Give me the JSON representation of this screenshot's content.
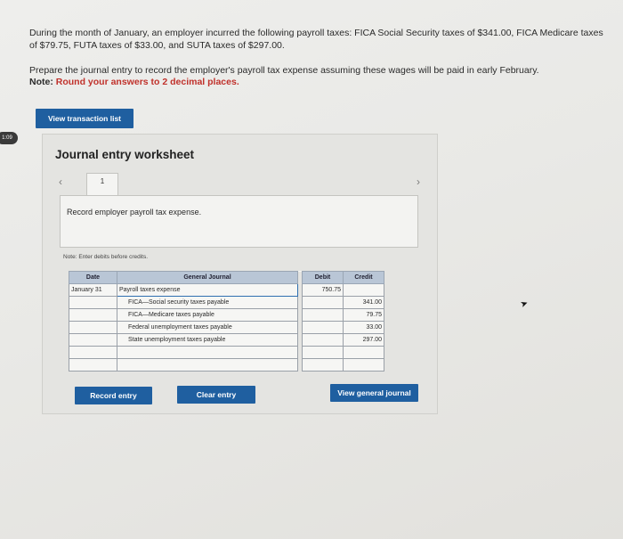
{
  "question": {
    "line1": "During the month of January, an employer incurred the following payroll taxes: FICA Social Security taxes of $341.00, FICA Medicare taxes of $79.75, FUTA taxes of $33.00, and SUTA taxes of $297.00.",
    "line2": "Prepare the journal entry to record the employer's payroll tax expense assuming these wages will be paid in early February.",
    "note_label": "Note:",
    "note_text": "Round your answers to 2 decimal places."
  },
  "buttons": {
    "view_transaction_list": "View transaction list",
    "record_entry": "Record entry",
    "clear_entry": "Clear entry",
    "view_general_journal": "View general journal"
  },
  "timer": "1:09",
  "worksheet": {
    "title": "Journal entry worksheet",
    "prev_icon": "‹",
    "next_icon": "›",
    "tab_number": "1",
    "record_text": "Record employer payroll tax expense.",
    "enter_note": "Note: Enter debits before credits."
  },
  "journal": {
    "headers": {
      "date": "Date",
      "general_journal": "General Journal",
      "debit": "Debit",
      "credit": "Credit"
    },
    "rows": [
      {
        "date": "January 31",
        "account": "Payroll taxes expense",
        "debit": "750.75",
        "credit": ""
      },
      {
        "date": "",
        "account": "FICA—Social security taxes payable",
        "debit": "",
        "credit": "341.00"
      },
      {
        "date": "",
        "account": "FICA—Medicare taxes payable",
        "debit": "",
        "credit": "79.75"
      },
      {
        "date": "",
        "account": "Federal unemployment taxes payable",
        "debit": "",
        "credit": "33.00"
      },
      {
        "date": "",
        "account": "State unemployment taxes payable",
        "debit": "",
        "credit": "297.00"
      },
      {
        "date": "",
        "account": "",
        "debit": "",
        "credit": ""
      },
      {
        "date": "",
        "account": "",
        "debit": "",
        "credit": ""
      }
    ]
  },
  "colors": {
    "button_blue": "#1f5fa0",
    "table_header": "#b9c6d6",
    "note_red": "#c0312b"
  }
}
